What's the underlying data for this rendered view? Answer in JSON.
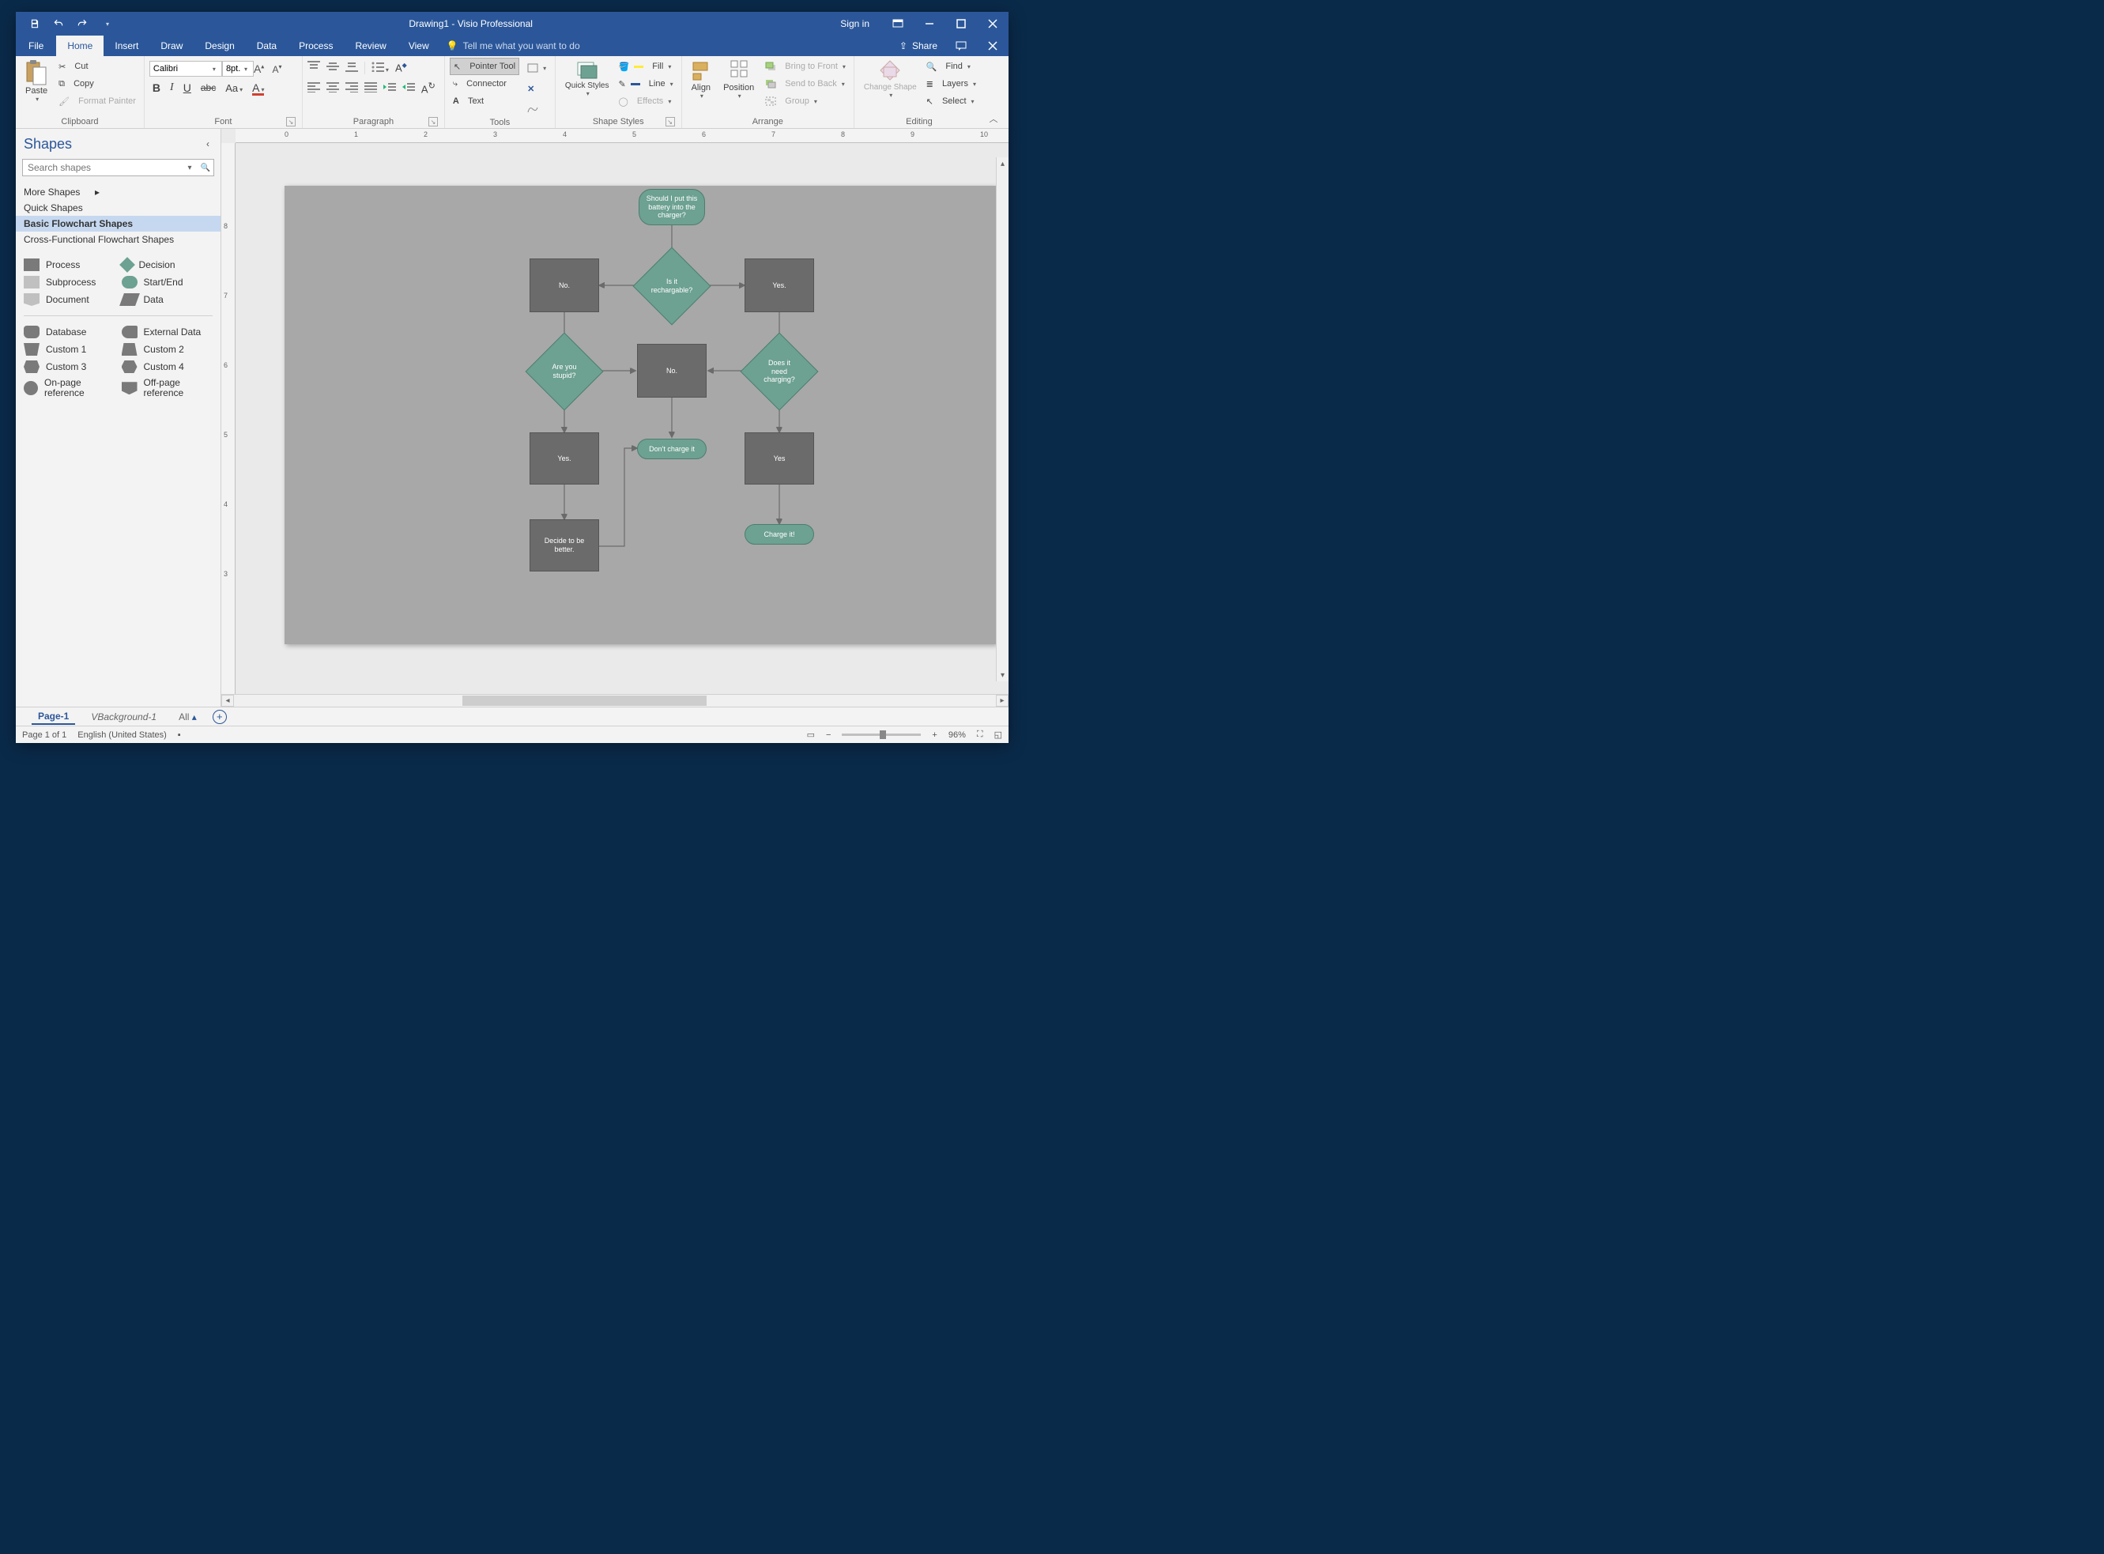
{
  "titlebar": {
    "doc_title": "Drawing1  -  Visio Professional",
    "signin": "Sign in"
  },
  "menubar": {
    "tabs": [
      "File",
      "Home",
      "Insert",
      "Draw",
      "Design",
      "Data",
      "Process",
      "Review",
      "View"
    ],
    "active": "Home",
    "tellme": "Tell me what you want to do",
    "share": "Share"
  },
  "ribbon": {
    "clipboard": {
      "paste": "Paste",
      "cut": "Cut",
      "copy": "Copy",
      "format_painter": "Format Painter",
      "label": "Clipboard"
    },
    "font": {
      "name": "Calibri",
      "size": "8pt.",
      "label": "Font"
    },
    "paragraph": {
      "label": "Paragraph"
    },
    "tools": {
      "pointer": "Pointer Tool",
      "connector": "Connector",
      "text": "Text",
      "label": "Tools"
    },
    "shape_styles": {
      "quick_styles": "Quick Styles",
      "fill": "Fill",
      "line": "Line",
      "effects": "Effects",
      "label": "Shape Styles"
    },
    "arrange": {
      "align": "Align",
      "position": "Position",
      "bring_front": "Bring to Front",
      "send_back": "Send to Back",
      "group": "Group",
      "label": "Arrange"
    },
    "editing": {
      "change_shape": "Change Shape",
      "find": "Find",
      "layers": "Layers",
      "select": "Select",
      "label": "Editing"
    }
  },
  "sidebar": {
    "title": "Shapes",
    "search_placeholder": "Search shapes",
    "more_shapes": "More Shapes",
    "stencils": [
      "Quick Shapes",
      "Basic Flowchart Shapes",
      "Cross-Functional Flowchart Shapes"
    ],
    "selected_stencil": "Basic Flowchart Shapes",
    "shapes_row1": [
      {
        "name": "Process"
      },
      {
        "name": "Decision"
      },
      {
        "name": "Subprocess"
      },
      {
        "name": "Start/End"
      },
      {
        "name": "Document"
      },
      {
        "name": "Data"
      }
    ],
    "shapes_row2": [
      {
        "name": "Database"
      },
      {
        "name": "External Data"
      },
      {
        "name": "Custom 1"
      },
      {
        "name": "Custom 2"
      },
      {
        "name": "Custom 3"
      },
      {
        "name": "Custom 4"
      },
      {
        "name": "On-page reference"
      },
      {
        "name": "Off-page reference"
      }
    ]
  },
  "ruler_h": [
    "0",
    "1",
    "2",
    "3",
    "4",
    "5",
    "6",
    "7",
    "8",
    "9",
    "10"
  ],
  "ruler_v": [
    "8",
    "7",
    "6",
    "5",
    "4",
    "3"
  ],
  "flowchart": {
    "start": "Should I put this battery into the charger?",
    "is_rechargeable": "Is it rechargable?",
    "no1": "No.",
    "yes1": "Yes.",
    "are_you_stupid": "Are you stupid?",
    "no2": "No.",
    "does_need": "Does it need charging?",
    "yes2": "Yes.",
    "dont_charge": "Don't charge it",
    "yes3": "Yes",
    "decide_better": "Decide to be better.",
    "charge_it": "Charge it!"
  },
  "tabbar": {
    "page1": "Page-1",
    "vbackground": "VBackground-1",
    "all": "All"
  },
  "statusbar": {
    "page_info": "Page 1 of 1",
    "language": "English (United States)",
    "zoom": "96%"
  }
}
